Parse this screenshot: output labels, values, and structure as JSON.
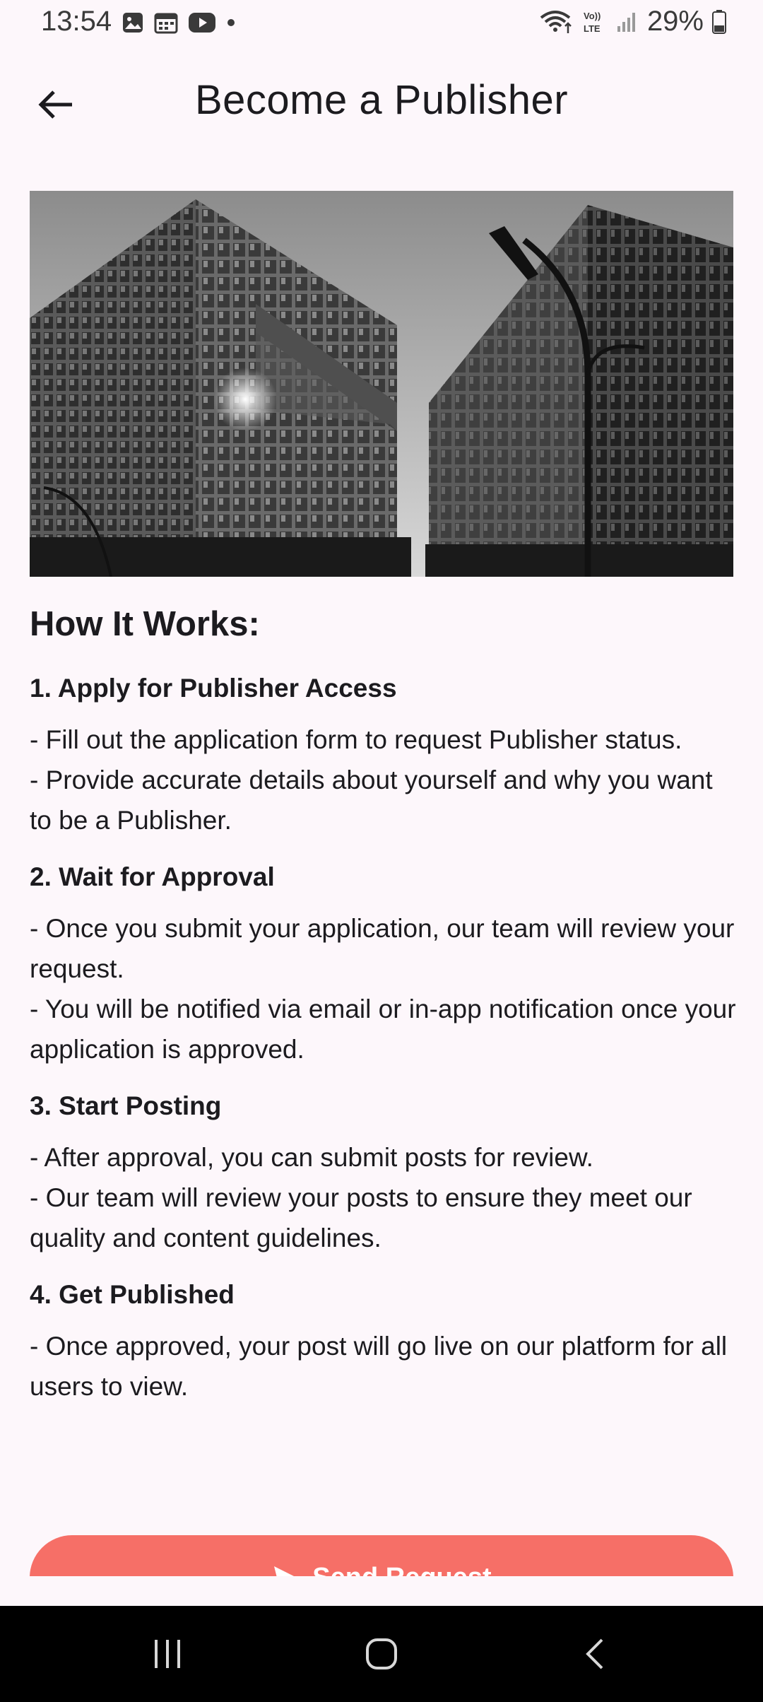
{
  "status_bar": {
    "time": "13:54",
    "battery_percent": "29%",
    "left_icons": [
      "gallery-icon",
      "calendar-icon",
      "youtube-icon",
      "dot-icon"
    ],
    "right_icons": [
      "wifi-icon",
      "volte-icon",
      "signal-icon",
      "battery-icon"
    ]
  },
  "app_bar": {
    "title": "Become a Publisher",
    "back_icon": "arrow-back-icon"
  },
  "content": {
    "heading": "How It Works:",
    "steps": [
      {
        "title": "1. Apply for Publisher Access",
        "lines": [
          "- Fill out the application form to request Publisher status.",
          "- Provide accurate details about yourself and why you want to be a Publisher."
        ]
      },
      {
        "title": "2. Wait for Approval",
        "lines": [
          "- Once you submit your application, our team will review your request.",
          "- You will be notified via email or in-app notification once your application is approved."
        ]
      },
      {
        "title": "3. Start Posting",
        "lines": [
          "- After approval, you can submit posts for review.",
          "- Our team will review your posts to ensure they meet our quality and content guidelines."
        ]
      },
      {
        "title": "4. Get Published",
        "lines": [
          "- Once approved, your post will go live on our platform for all users to view."
        ]
      }
    ]
  },
  "send_button": {
    "label": "Send Request",
    "icon": "send-icon",
    "color": "#f66f67"
  },
  "nav_bar": {
    "buttons": [
      "recent-apps-icon",
      "home-icon",
      "back-icon"
    ]
  }
}
